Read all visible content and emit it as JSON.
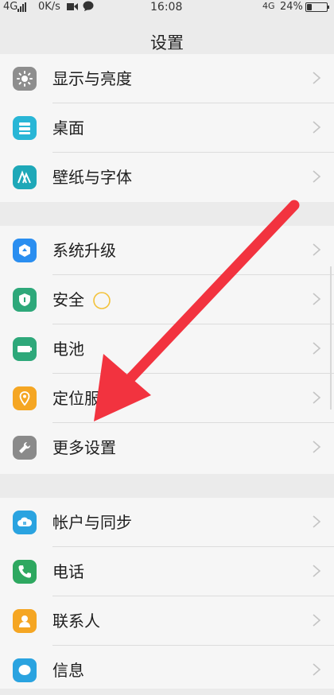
{
  "status_bar": {
    "network": "4G",
    "speed": "0K/s",
    "time": "16:08",
    "net_right": "4G",
    "battery": "24%",
    "battery_level": 0.24
  },
  "title": "设置",
  "groups": [
    {
      "items": [
        {
          "label": "显示与亮度",
          "icon": "brightness-icon",
          "color": "#8e8e8e"
        },
        {
          "label": "桌面",
          "icon": "desktop-icon",
          "color": "#29b6d6"
        },
        {
          "label": "壁纸与字体",
          "icon": "wallpaper-font-icon",
          "color": "#1ea8b8"
        }
      ]
    },
    {
      "items": [
        {
          "label": "系统升级",
          "icon": "system-upgrade-icon",
          "color": "#2a8ef0"
        },
        {
          "label": "安全",
          "icon": "shield-icon",
          "color": "#2ea87a"
        },
        {
          "label": "电池",
          "icon": "battery-icon",
          "color": "#2ea87a"
        },
        {
          "label": "定位服",
          "icon": "location-icon",
          "color": "#f5a623"
        },
        {
          "label": "更多设置",
          "icon": "wrench-icon",
          "color": "#8a8a8a"
        }
      ]
    },
    {
      "items": [
        {
          "label": "帐户与同步",
          "icon": "cloud-icon",
          "color": "#2aa3e0"
        },
        {
          "label": "电话",
          "icon": "phone-icon",
          "color": "#2ea860"
        },
        {
          "label": "联系人",
          "icon": "contacts-icon",
          "color": "#f5a623"
        },
        {
          "label": "信息",
          "icon": "message-icon",
          "color": "#2aa3e0"
        }
      ]
    }
  ],
  "annotation": {
    "arrow_color": "#f2333f",
    "circle_color": "#f3c23a"
  }
}
